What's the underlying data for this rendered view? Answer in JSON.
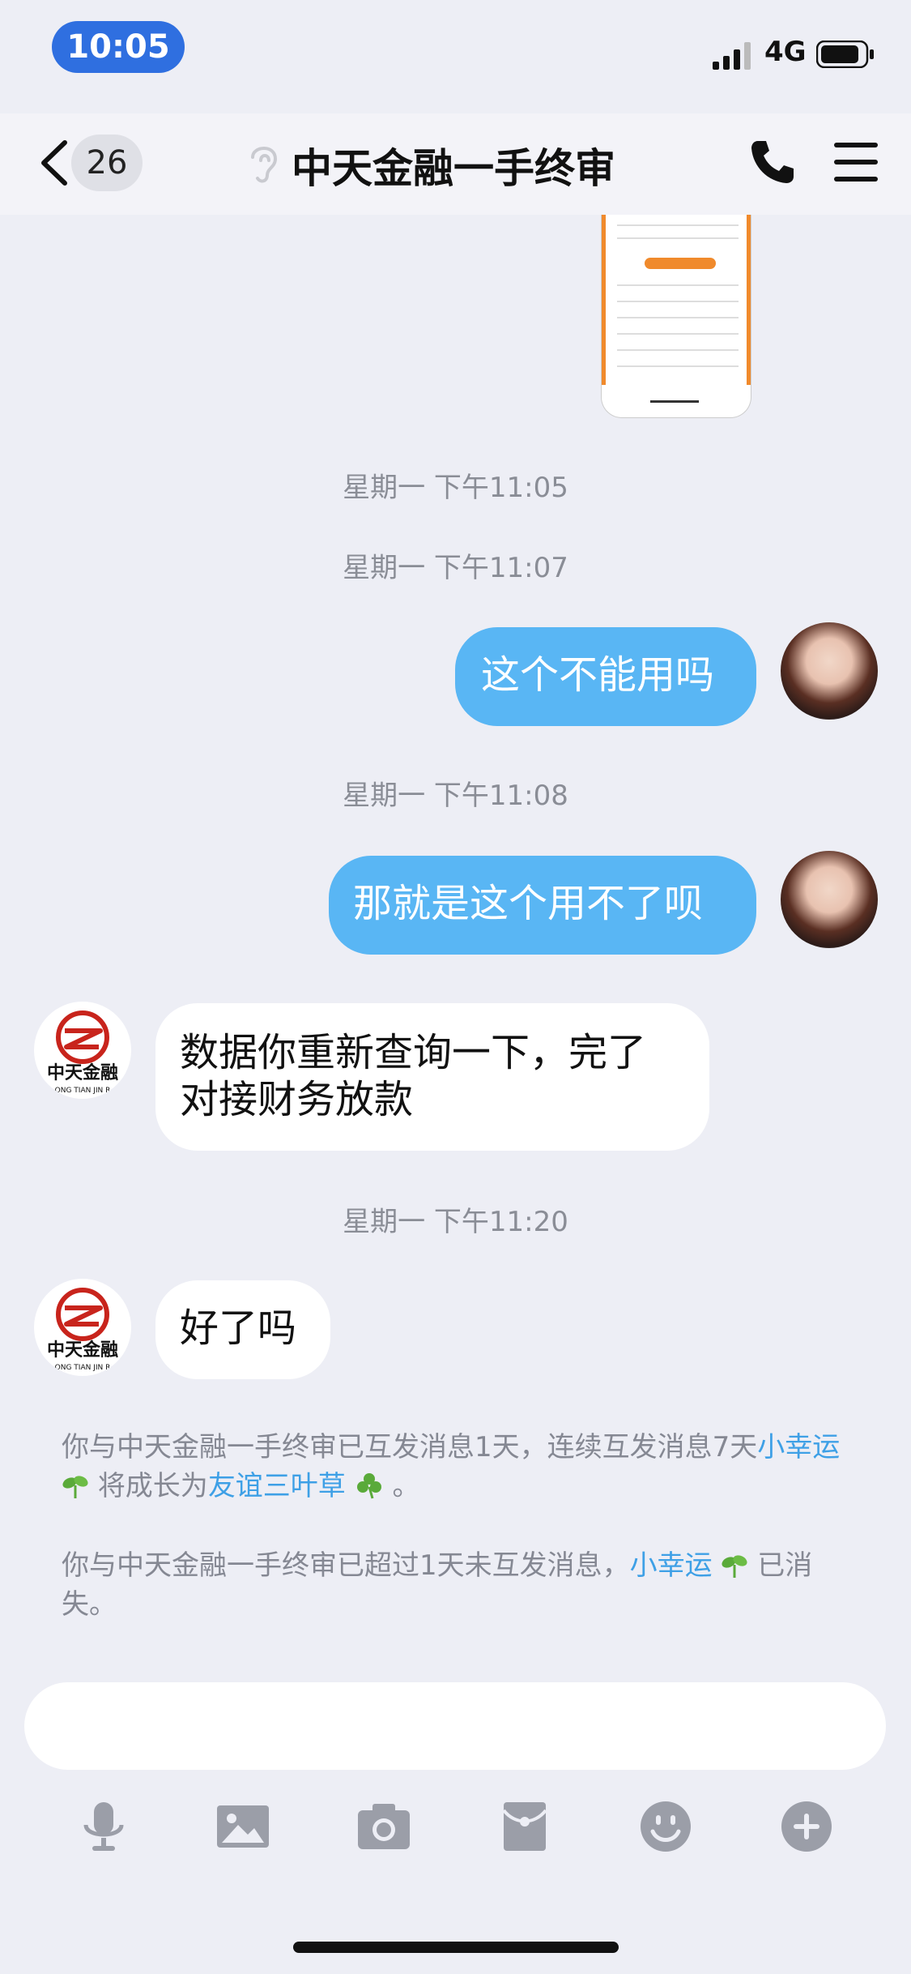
{
  "status_bar": {
    "time": "10:05",
    "network": "4G"
  },
  "header": {
    "back_count": "26",
    "title": "中天金融一手终审"
  },
  "timestamps": [
    "星期一 下午11:05",
    "星期一 下午11:07",
    "星期一 下午11:08",
    "星期一 下午11:20"
  ],
  "messages": [
    {
      "side": "out",
      "text": "这个不能用吗"
    },
    {
      "side": "out",
      "text": "那就是这个用不了呗"
    },
    {
      "side": "in",
      "text_line1": "数据你重新查询一下，完了",
      "text_line2": "对接财务放款"
    },
    {
      "side": "in",
      "text": "好了吗"
    }
  ],
  "contact_logo": {
    "name": "中天金融",
    "subtitle": "ONG TIAN JIN R"
  },
  "notes": {
    "note1": {
      "part1": "你与中天金融一手终审已互发消息1天，连续互发消息7天",
      "link1": "小幸运",
      "part2": "将成长为",
      "link2": "友谊三叶草",
      "part3": "。"
    },
    "note2": {
      "part1": "你与中天金融一手终审已超过1天未互发消息，",
      "link1": "小幸运",
      "part2": "已消失。"
    }
  },
  "toolbar_icons": [
    "microphone-icon",
    "image-icon",
    "camera-icon",
    "red-packet-icon",
    "emoji-icon",
    "plus-icon"
  ],
  "colors": {
    "accent": "#59b6f4",
    "link": "#3ea0e6",
    "background": "#edeef5",
    "time_pill": "#2f6fe0"
  }
}
